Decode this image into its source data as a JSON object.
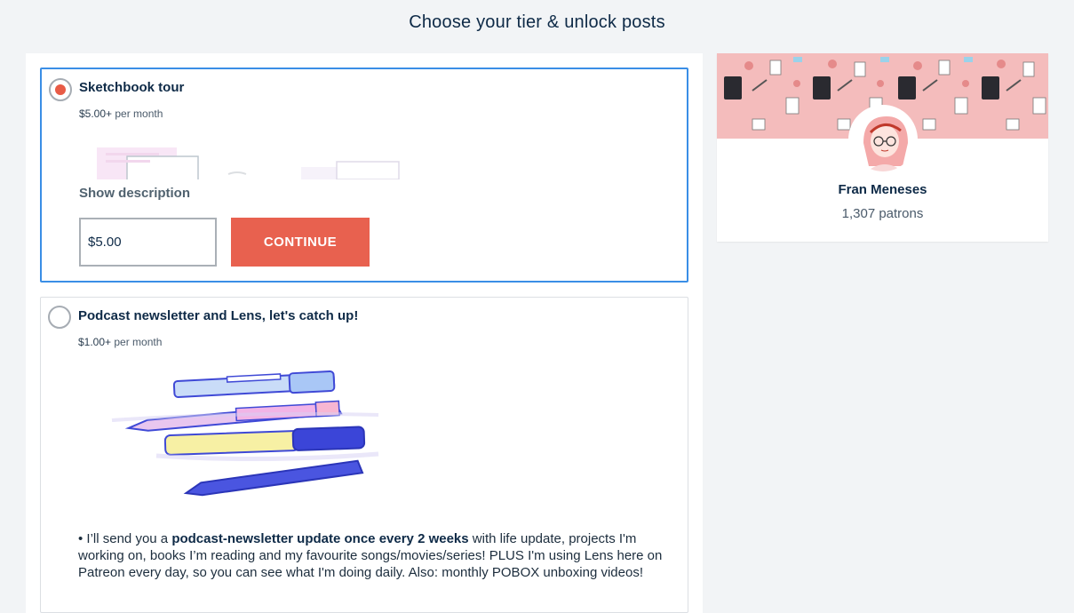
{
  "page": {
    "title": "Choose your tier & unlock posts"
  },
  "tiers": [
    {
      "title": "Sketchbook tour",
      "price_amount": "$5.00+",
      "price_period": " per month",
      "selected": true,
      "show_description_label": "Show description",
      "amount_value": "$5.00",
      "continue_label": "CONTINUE"
    },
    {
      "title": "Podcast newsletter and Lens, let's catch up!",
      "price_amount": "$1.00+",
      "price_period": " per month",
      "selected": false,
      "description": {
        "part1": "• I’ll send you a ",
        "bold": "podcast-newsletter update once every 2 weeks",
        "part2": " with life update, projects I'm working on, books I’m reading and my favourite songs/movies/series! PLUS I'm using Lens here on Patreon every day, so you can see what I'm doing daily. Also: monthly POBOX unboxing videos!"
      }
    }
  ],
  "creator": {
    "name": "Fran Meneses",
    "patrons": "1,307 patrons"
  },
  "colors": {
    "accent": "#e8614f",
    "selected_border": "#3a8ee6",
    "banner": "#f4bcbc",
    "text": "#0e2a47"
  }
}
